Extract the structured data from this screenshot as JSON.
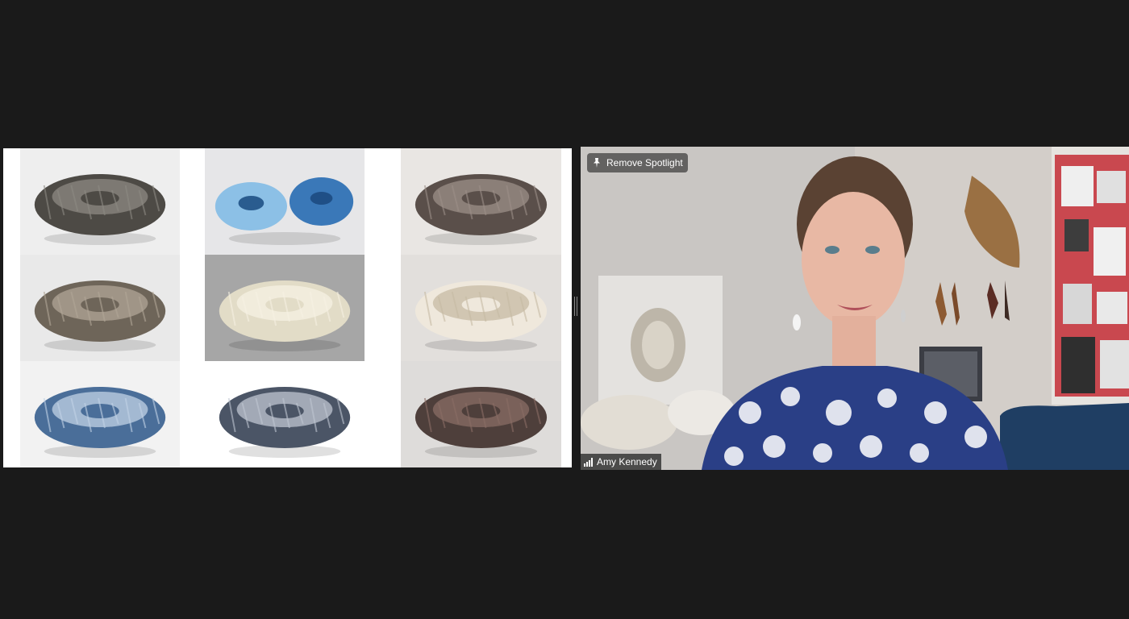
{
  "shared_screen": {
    "tiles": [
      {
        "name": "sculpture-dark-grey",
        "bg": "#eeeeee",
        "body": "#4d4a45",
        "accent": "#8d8a83"
      },
      {
        "name": "sculpture-blue-pair",
        "bg": "#e6e6e8",
        "body": "#3a78b8",
        "accent": "#8cc0e6"
      },
      {
        "name": "sculpture-dark-flat",
        "bg": "#e9e6e3",
        "body": "#5a4f4a",
        "accent": "#9c8f88"
      },
      {
        "name": "sculpture-grey-bronze",
        "bg": "#e9e9e9",
        "body": "#6e6559",
        "accent": "#b1a697"
      },
      {
        "name": "sculpture-cream",
        "bg": "#a6a6a6",
        "body": "#e2dcc7",
        "accent": "#f6f1e3"
      },
      {
        "name": "sculpture-white-dish",
        "bg": "#e2dfdc",
        "body": "#efe8dc",
        "accent": "#c7bba4"
      },
      {
        "name": "sculpture-blue-wave",
        "bg": "#f2f2f2",
        "body": "#4a6e99",
        "accent": "#c2d3e6"
      },
      {
        "name": "sculpture-blue-grey-bowl",
        "bg": "#ffffff",
        "body": "#4b5566",
        "accent": "#bfc6d1"
      },
      {
        "name": "sculpture-dark-closeup",
        "bg": "#dedcda",
        "body": "#4e3f3b",
        "accent": "#8a6d65"
      }
    ]
  },
  "video": {
    "spotlight_button_label": "Remove Spotlight",
    "participant_name": "Amy Kennedy"
  },
  "icons": {
    "pin": "pin-icon",
    "signal": "signal-strength-icon"
  }
}
